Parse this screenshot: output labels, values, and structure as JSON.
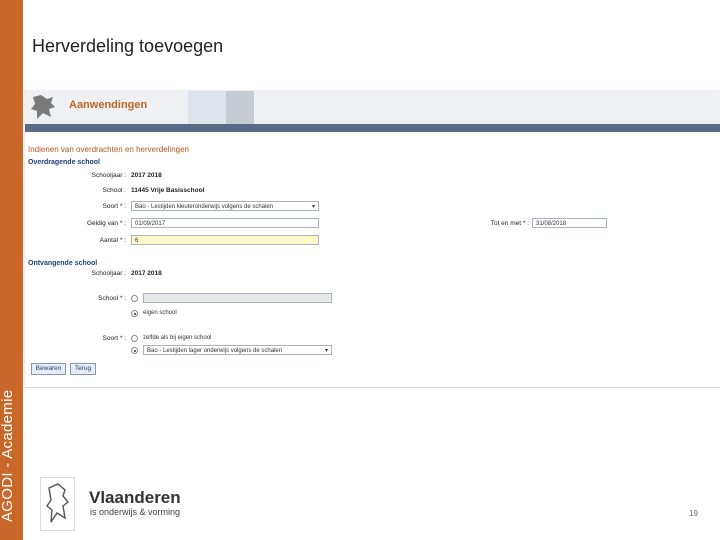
{
  "sidebar": {
    "label": "AGODI - Academie"
  },
  "slide": {
    "title": "Herverdeling toevoegen",
    "page_number": "19"
  },
  "app": {
    "title": "Aanwendingen"
  },
  "form": {
    "title": "Indienen van overdrachten en herverdelingen",
    "overdragende": {
      "heading": "Overdragende school",
      "schooljaar_label": "Schooljaar :",
      "schooljaar_value": "2017 2018",
      "school_label": "School :",
      "school_value": "11445 Vrije Basisschool",
      "soort_label": "Soort * :",
      "soort_value": "Bao - Lestijden kleuteronderwijs volgens de schalen",
      "geldig_label": "Geldig van * :",
      "geldig_value": "01/09/2017",
      "tot_label": "Tot en met * :",
      "tot_value": "31/08/2018",
      "aantal_label": "Aantal * :",
      "aantal_value": "6"
    },
    "ontvangende": {
      "heading": "Ontvangende school",
      "schooljaar_label": "Schooljaar :",
      "schooljaar_value": "2017 2018",
      "school_label": "School * :",
      "eigen_school": "eigen school",
      "soort_label": "Soort * :",
      "soort_option1": "zelfde als bij eigen school",
      "soort_value": "Bao - Lestijden lager onderwijs volgens de schalen"
    },
    "buttons": {
      "save": "Bewaren",
      "back": "Terug"
    }
  },
  "footer": {
    "brand": "Vlaanderen",
    "tagline": "is onderwijs & vorming"
  },
  "colors": {
    "sidebar": "#c9662a",
    "nav_strip": "#5a6b86",
    "accent_orange": "#c0661f",
    "section_blue": "#1f3f7a"
  }
}
